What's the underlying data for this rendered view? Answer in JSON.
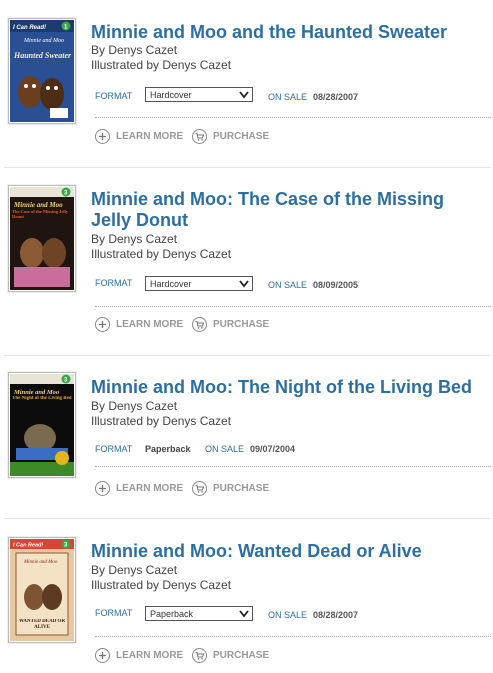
{
  "labels": {
    "format": "FORMAT",
    "on_sale": "ON SALE",
    "learn_more": "LEARN MORE",
    "purchase": "PURCHASE"
  },
  "colors": {
    "title": "#2e6fa0",
    "link": "#2e6fa0",
    "action": "#999999"
  },
  "books": [
    {
      "title": "Minnie and Moo and the Haunted Sweater",
      "author": "By Denys Cazet",
      "illustrator": "Illustrated by Denys Cazet",
      "format": "Hardcover",
      "format_control": "select",
      "on_sale_date": "08/28/2007",
      "cover_level": "1",
      "cover_text_1": "Minnie and Moo",
      "cover_text_2": "Haunted Sweater"
    },
    {
      "title": "Minnie and Moo: The Case of the Missing Jelly Donut",
      "author": "By Denys Cazet",
      "illustrator": "Illustrated by Denys Cazet",
      "format": "Hardcover",
      "format_control": "select",
      "on_sale_date": "08/09/2005",
      "cover_level": "3",
      "cover_text_1": "Minnie and Moo",
      "cover_text_2": "The Case of the Missing Jelly Donut"
    },
    {
      "title": "Minnie and Moo: The Night of the Living Bed",
      "author": "By Denys Cazet",
      "illustrator": "Illustrated by Denys Cazet",
      "format": "Paperback",
      "format_control": "static",
      "on_sale_date": "09/07/2004",
      "cover_level": "3",
      "cover_text_1": "Minnie and Moo",
      "cover_text_2": "The Night of the Living Bed"
    },
    {
      "title": "Minnie and Moo: Wanted Dead or Alive",
      "author": "By Denys Cazet",
      "illustrator": "Illustrated by Denys Cazet",
      "format": "Paperback",
      "format_control": "select",
      "on_sale_date": "08/28/2007",
      "cover_level": "3",
      "cover_text_1": "Minnie and Moo",
      "cover_text_2": "WANTED DEAD OR ALIVE"
    }
  ]
}
